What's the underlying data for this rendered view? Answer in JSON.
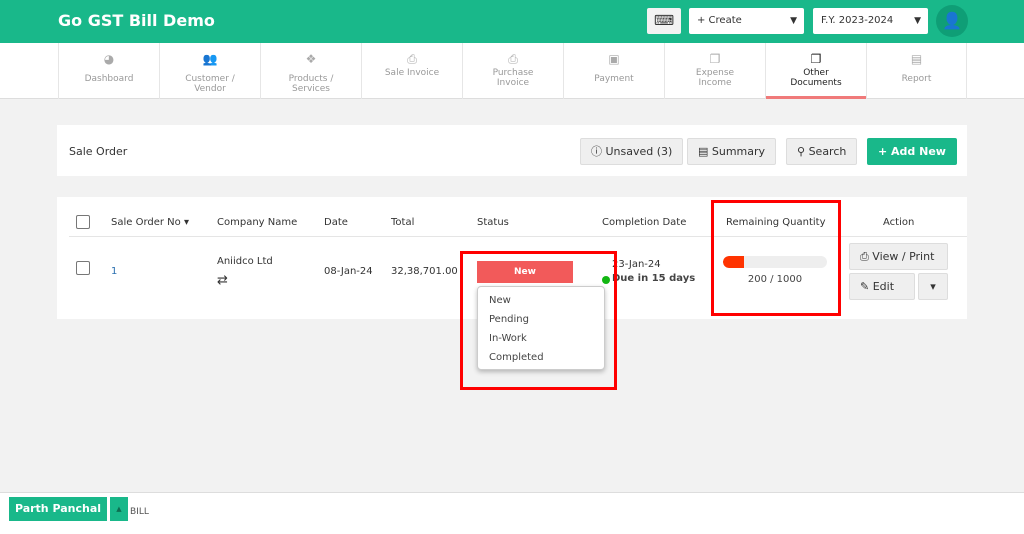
{
  "app": {
    "title": "Go GST Bill Demo",
    "create_label": "+ Create",
    "fy_label": "F.Y. 2023-2024"
  },
  "nav": [
    {
      "label": "Dashboard",
      "icon": "dashboard-icon",
      "glyph": "◕"
    },
    {
      "label": "Customer / Vendor",
      "icon": "users-icon",
      "glyph": "👥"
    },
    {
      "label": "Products / Services",
      "icon": "cubes-icon",
      "glyph": "❖"
    },
    {
      "label": "Sale Invoice",
      "icon": "printer-icon",
      "glyph": "⎙"
    },
    {
      "label": "Purchase Invoice",
      "icon": "printer-icon",
      "glyph": "⎙"
    },
    {
      "label": "Payment",
      "icon": "money-icon",
      "glyph": "▣"
    },
    {
      "label": "Expense Income",
      "icon": "copy-icon",
      "glyph": "❐"
    },
    {
      "label": "Other Documents",
      "icon": "copy-icon",
      "glyph": "❐"
    },
    {
      "label": "Report",
      "icon": "newspaper-icon",
      "glyph": "▤"
    }
  ],
  "header": {
    "title": "Sale Order",
    "unsaved": "Unsaved (3)",
    "summary": "Summary",
    "search": "Search",
    "add_new": "+ Add New"
  },
  "table": {
    "columns": [
      "Sale Order No ▾",
      "Company Name",
      "Date",
      "Total",
      "Status",
      "Completion Date",
      "Remaining Quantity",
      "Action"
    ],
    "row": {
      "no": "1",
      "company": "Aniidco Ltd",
      "date": "08-Jan-24",
      "total": "32,38,701.00",
      "status": "New",
      "completion_date": "23-Jan-24",
      "due": "Due in 15 days",
      "remaining": "200 / 1000",
      "remaining_fraction": 0.2,
      "view_print": "View / Print",
      "edit": "Edit"
    }
  },
  "status_options": [
    "New",
    "Pending",
    "In-Work",
    "Completed"
  ],
  "colors": {
    "brand": "#19b88a",
    "status_new": "#f25a5a",
    "progress": "#ff3300",
    "highlight": "#ff0000"
  },
  "footer": {
    "user": "Parth Panchal",
    "bill": "BILL"
  }
}
